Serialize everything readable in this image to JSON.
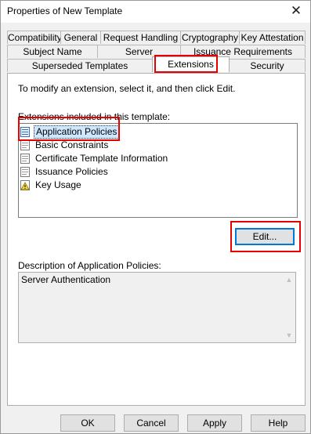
{
  "window": {
    "title": "Properties of New Template",
    "close_glyph": "✕"
  },
  "tabs": {
    "row1": [
      "Compatibility",
      "General",
      "Request Handling",
      "Cryptography",
      "Key Attestation"
    ],
    "row2": [
      "Subject Name",
      "Server",
      "Issuance Requirements"
    ],
    "row3": [
      "Superseded Templates",
      "Extensions",
      "Security"
    ],
    "active": "Extensions"
  },
  "panel": {
    "instruction": "To modify an extension, select it, and then click Edit.",
    "list_label": "Extensions included in this template:",
    "extensions": [
      {
        "label": "Application Policies",
        "icon": "policy-icon",
        "selected": true
      },
      {
        "label": "Basic Constraints",
        "icon": "document-icon",
        "selected": false
      },
      {
        "label": "Certificate Template Information",
        "icon": "document-icon",
        "selected": false
      },
      {
        "label": "Issuance Policies",
        "icon": "document-icon",
        "selected": false
      },
      {
        "label": "Key Usage",
        "icon": "warning-icon",
        "selected": false
      }
    ],
    "edit_button": "Edit...",
    "description_label": "Description of Application Policies:",
    "description_text": "Server Authentication"
  },
  "buttons": {
    "ok": "OK",
    "cancel": "Cancel",
    "apply": "Apply",
    "help": "Help"
  },
  "colors": {
    "highlight_box": "#e60000",
    "selection": "#cde8ff",
    "default_button_border": "#0078d7"
  }
}
